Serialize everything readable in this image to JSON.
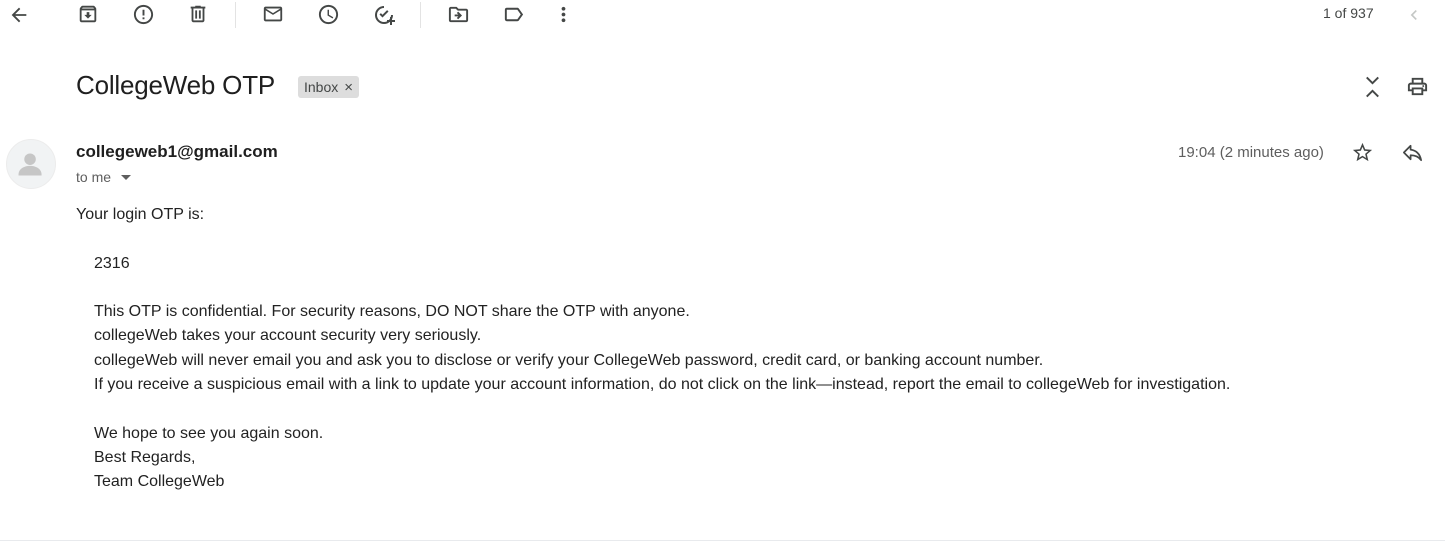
{
  "toolbar": {
    "back": "back-arrow-icon",
    "archive": "archive-icon",
    "report_spam": "report-spam-icon",
    "delete": "trash-icon",
    "mark_unread": "mail-icon",
    "snooze": "clock-icon",
    "add_task": "add-task-icon",
    "move_to": "move-to-folder-icon",
    "labels": "label-icon",
    "more": "more-vertical-icon"
  },
  "pager": {
    "text": "1 of 937"
  },
  "email": {
    "subject": "CollegeWeb OTP",
    "label": "Inbox",
    "label_remove": "×",
    "sender": "collegeweb1@gmail.com",
    "recipient": "to me",
    "time": "19:04 (2 minutes ago)",
    "body": {
      "greeting": "Your login OTP is:",
      "otp": "2316",
      "lines": [
        "This OTP is confidential. For security reasons, DO NOT share the OTP with anyone.",
        "collegeWeb takes your account security very seriously.",
        "collegeWeb will never email you and ask you to disclose or verify your CollegeWeb password, credit card, or banking account number.",
        "If you receive a suspicious email with a link to update your account information, do not click on the link—instead, report the email to collegeWeb for investigation."
      ],
      "closing": [
        "We hope to see you again soon.",
        "Best Regards,",
        "Team CollegeWeb"
      ]
    }
  },
  "colors": {
    "icon": "#444746",
    "text": "#1f1f1f",
    "muted": "#5e5e5e",
    "chip_bg": "#dddddd"
  }
}
